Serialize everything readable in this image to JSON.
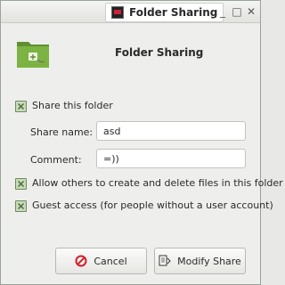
{
  "window": {
    "title": "Folder Sharing"
  },
  "header": {
    "title": "Folder Sharing"
  },
  "options": {
    "share_folder": {
      "label": "Share this folder",
      "checked": true
    },
    "allow_others": {
      "label": "Allow others to create and delete files in this folder",
      "checked": true
    },
    "guest_access": {
      "label": "Guest access (for people without a user account)",
      "checked": true
    }
  },
  "fields": {
    "share_name": {
      "label": "Share name:",
      "value": "asd"
    },
    "comment": {
      "label": "Comment:",
      "value": "=))"
    }
  },
  "buttons": {
    "cancel": "Cancel",
    "modify": "Modify Share"
  },
  "colors": {
    "folder_green": "#7cb342",
    "check_fill": "#c8dbb8",
    "cancel_red": "#d3202a"
  }
}
